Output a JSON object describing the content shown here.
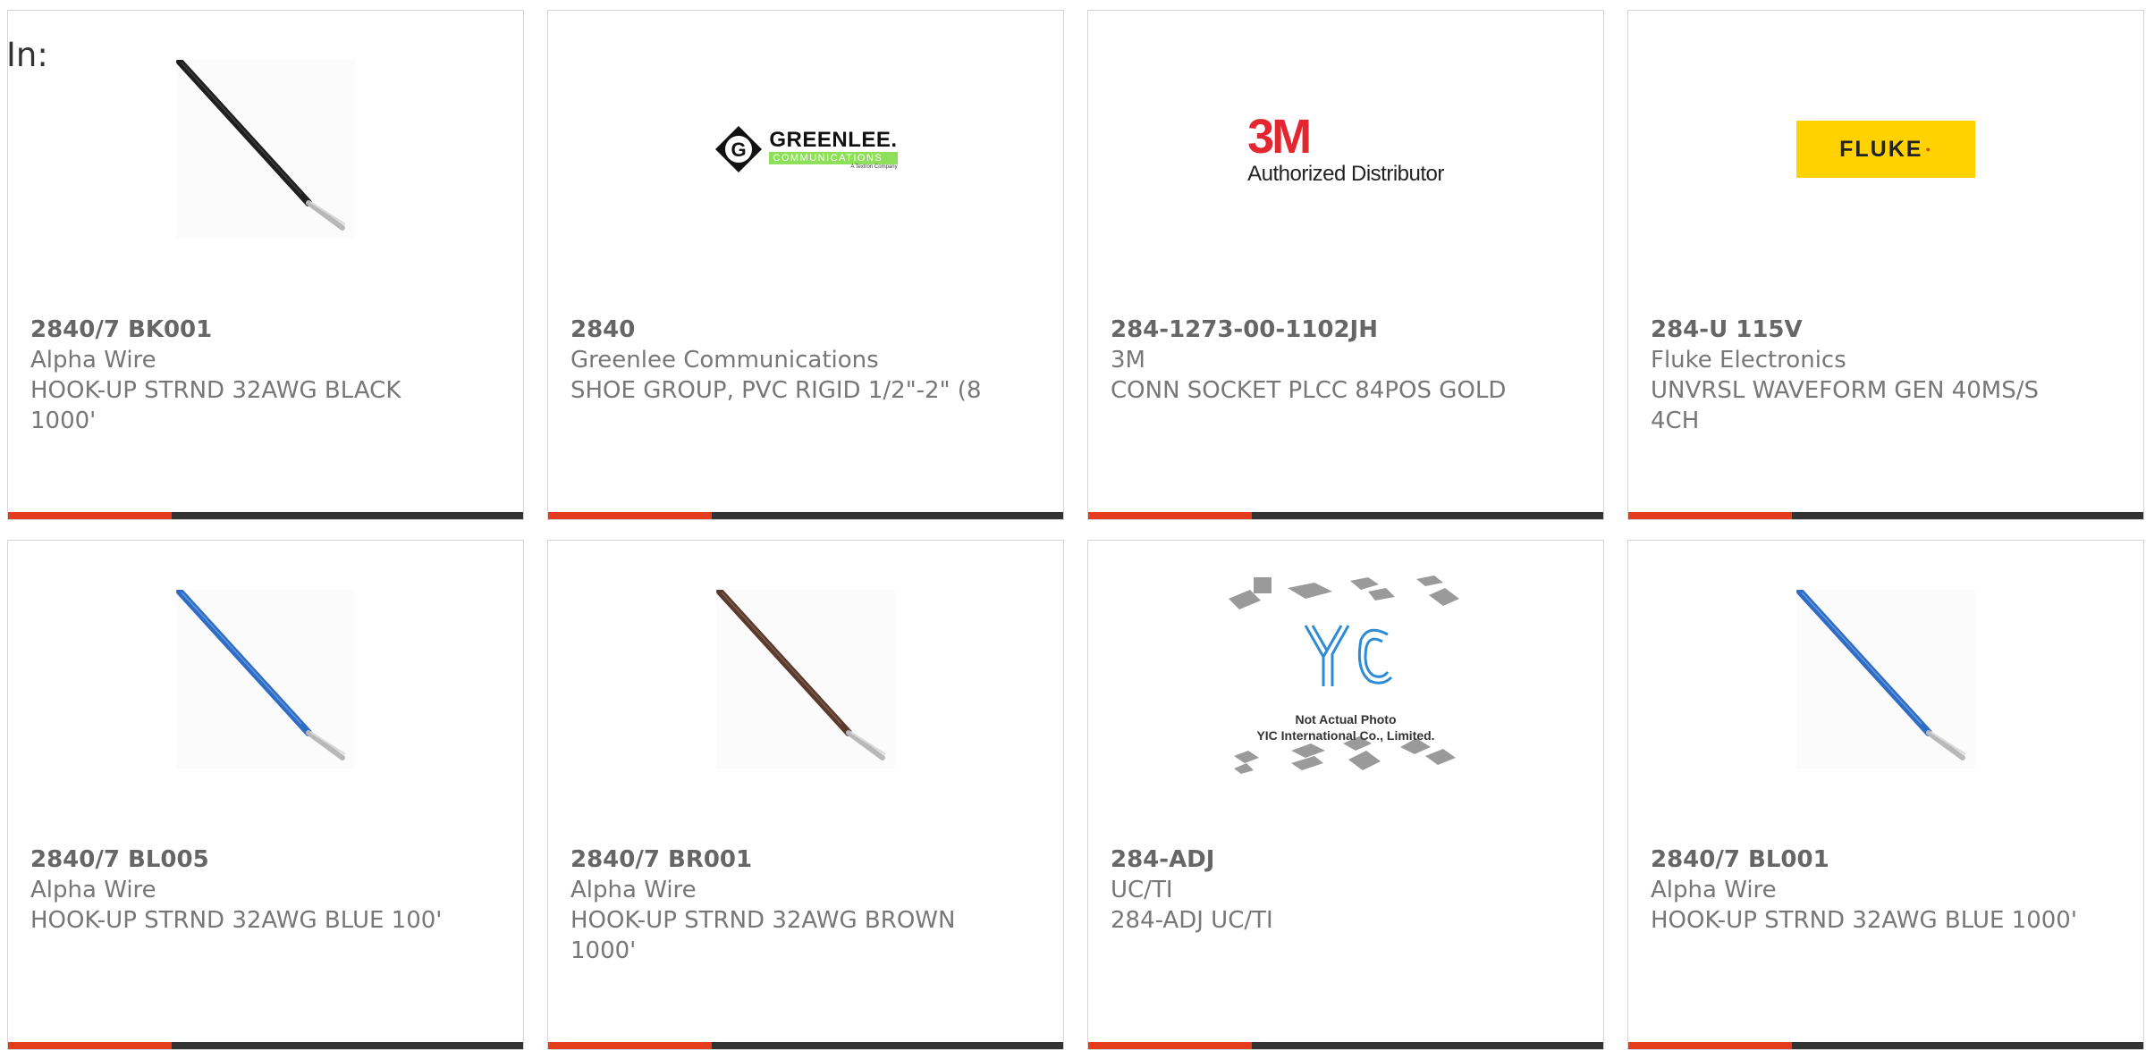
{
  "page": {
    "in_label": "In:"
  },
  "products": [
    {
      "part_number": "2840/7 BK001",
      "manufacturer": "Alpha Wire",
      "description": "HOOK-UP STRND 32AWG BLACK 1000'",
      "image": "wire-black-icon",
      "wire_color": "#1f1f1f"
    },
    {
      "part_number": "2840",
      "manufacturer": "Greenlee Communications",
      "description": "SHOE GROUP, PVC RIGID 1/2\"-2\" (8",
      "image": "greenlee-logo",
      "logo": {
        "name": "GREENLEE.",
        "sub": "COMMUNICATIONS",
        "tag": "A Textron Company"
      }
    },
    {
      "part_number": "284-1273-00-1102JH",
      "manufacturer": "3M",
      "description": "CONN SOCKET PLCC 84POS GOLD",
      "image": "3m-logo",
      "logo": {
        "mark": "3M",
        "sub": "Authorized Distributor"
      }
    },
    {
      "part_number": "284-U 115V",
      "manufacturer": "Fluke Electronics",
      "description": "UNVRSL WAVEFORM GEN 40MS/S 4CH",
      "image": "fluke-logo",
      "logo": {
        "mark": "FLUKE",
        "dot": "●"
      }
    },
    {
      "part_number": "2840/7 BL005",
      "manufacturer": "Alpha Wire",
      "description": "HOOK-UP STRND 32AWG BLUE 100'",
      "image": "wire-blue-icon",
      "wire_color": "#2f6cc4"
    },
    {
      "part_number": "2840/7 BR001",
      "manufacturer": "Alpha Wire",
      "description": "HOOK-UP STRND 32AWG BROWN 1000'",
      "image": "wire-brown-icon",
      "wire_color": "#5b3a2e"
    },
    {
      "part_number": "284-ADJ",
      "manufacturer": "UC/TI",
      "description": "284-ADJ UC/TI",
      "image": "yic-placeholder",
      "logo": {
        "line1": "Not Actual Photo",
        "line2": "YIC International Co., Limited."
      }
    },
    {
      "part_number": "2840/7 BL001",
      "manufacturer": "Alpha Wire",
      "description": "HOOK-UP STRND 32AWG BLUE 1000'",
      "image": "wire-blue-icon",
      "wire_color": "#2f6cc4"
    }
  ],
  "colors": {
    "accent": "#e63c1e",
    "bar": "#333333",
    "border": "#d5d5d5",
    "text": "#666666"
  }
}
